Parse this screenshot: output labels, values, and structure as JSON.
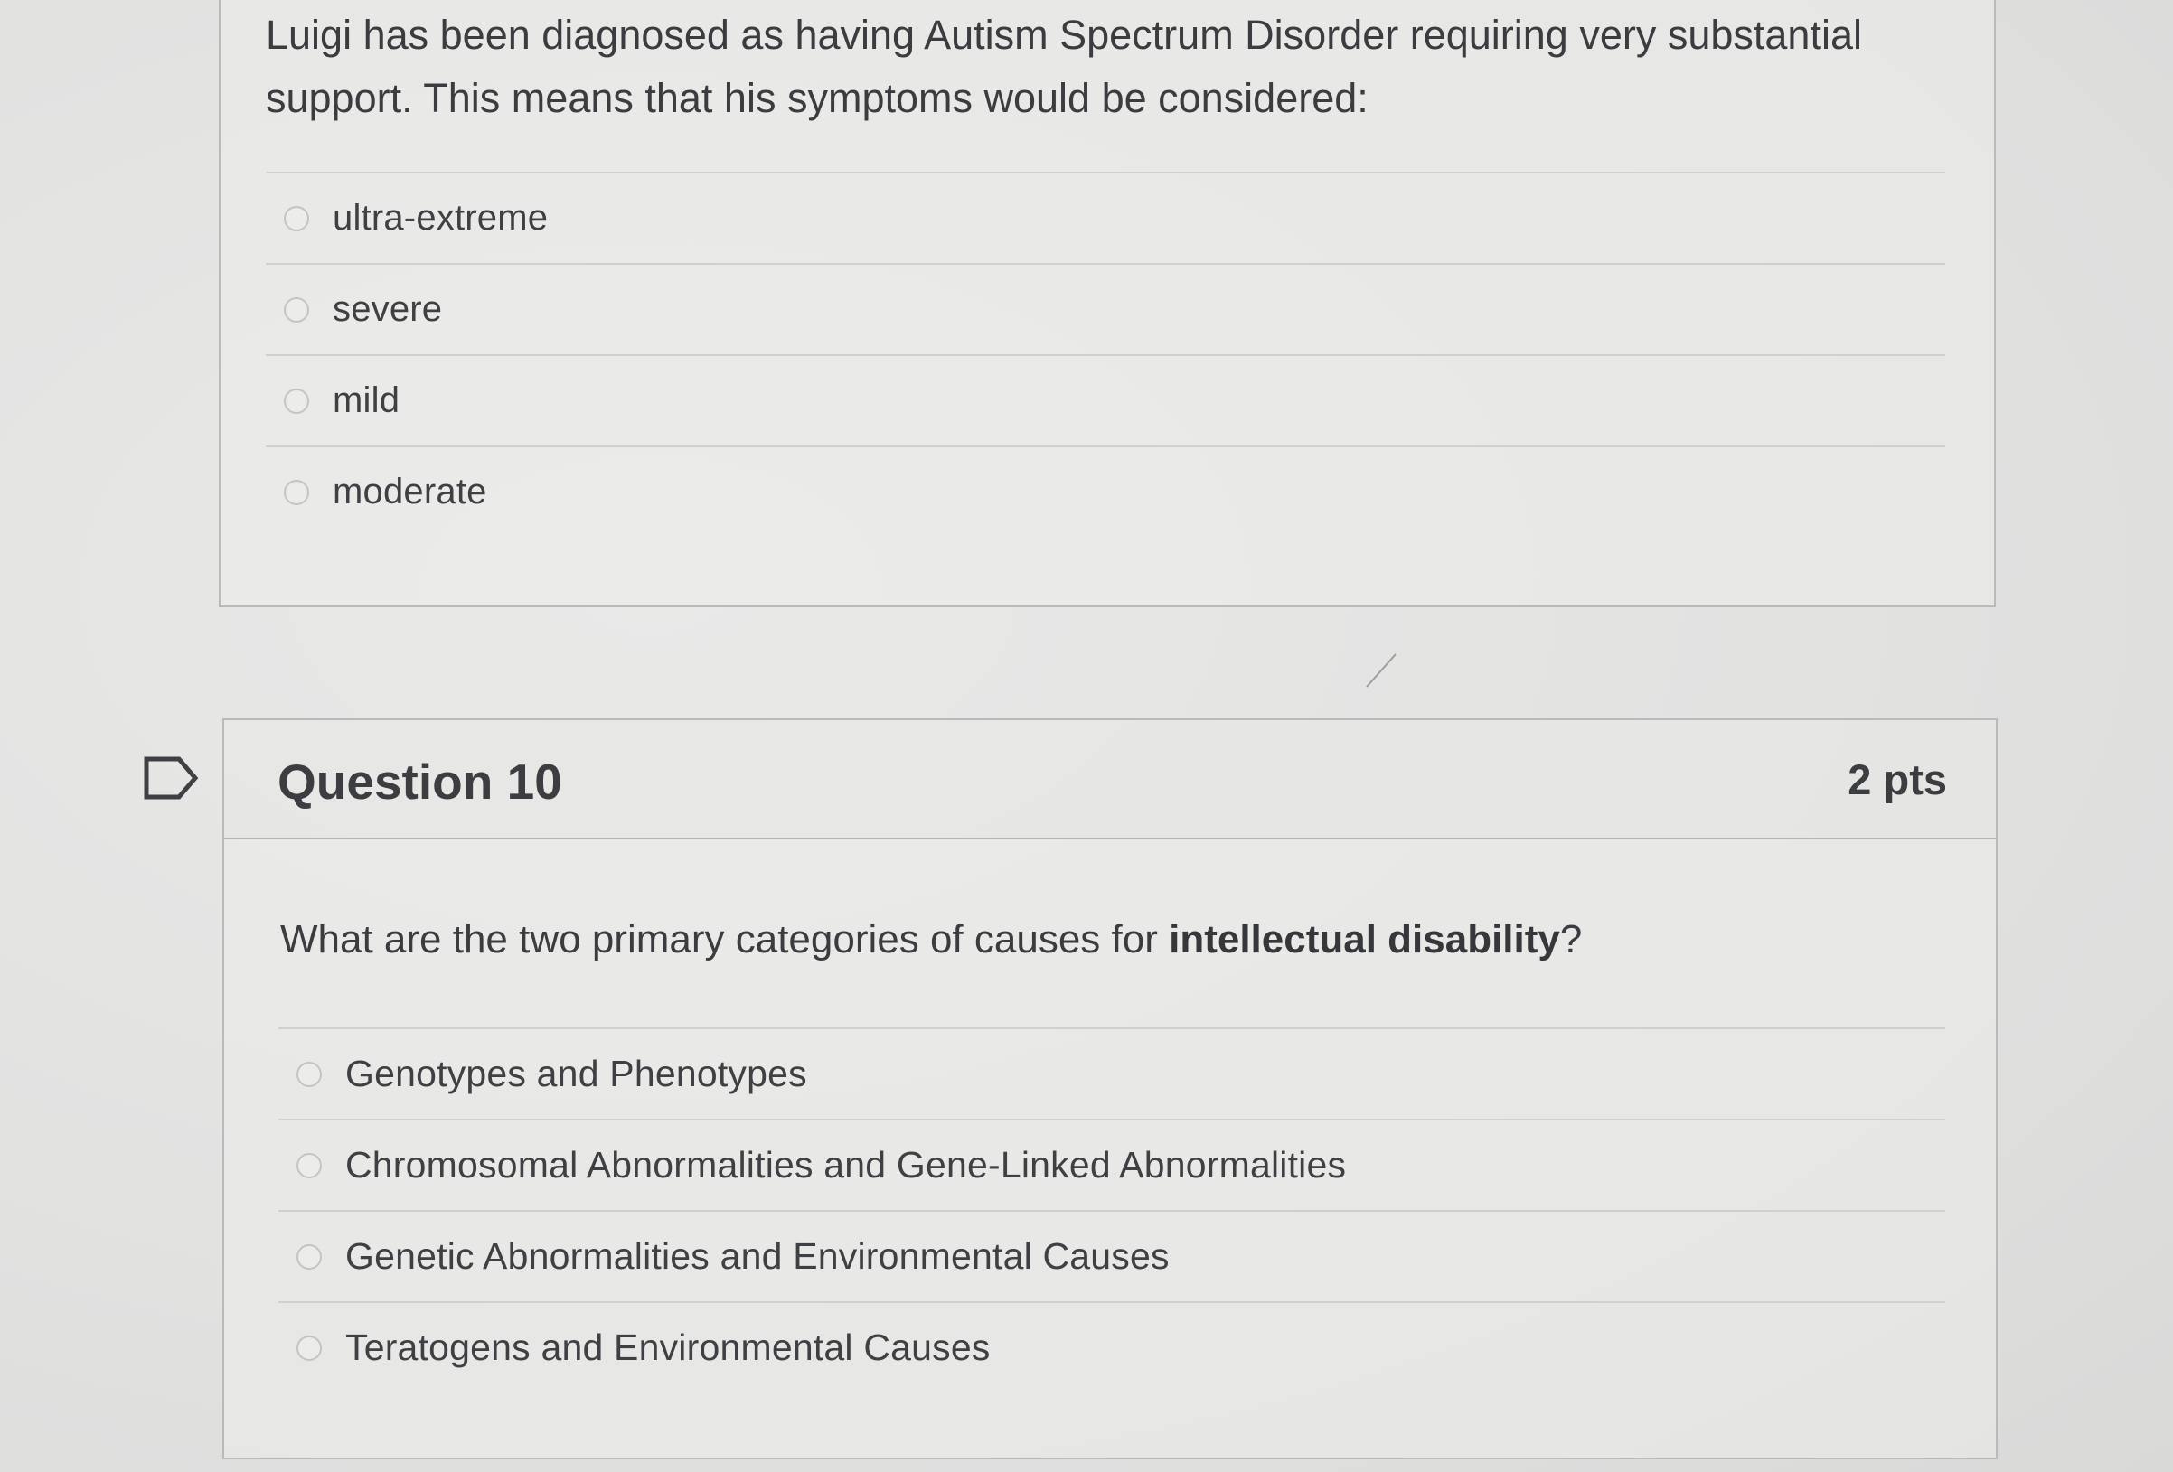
{
  "question_9": {
    "prompt": "Luigi has been diagnosed as having Autism Spectrum Disorder requiring very substantial support.  This means that his symptoms would be considered:",
    "answers": [
      {
        "label": "ultra-extreme"
      },
      {
        "label": "severe"
      },
      {
        "label": "mild"
      },
      {
        "label": "moderate"
      }
    ]
  },
  "question_10": {
    "title": "Question 10",
    "points": "2 pts",
    "prompt_start": "What are the two primary categories of causes for ",
    "prompt_bold": "intellectual disability",
    "prompt_end": "?",
    "answers": [
      {
        "label": "Genotypes and Phenotypes"
      },
      {
        "label": "Chromosomal Abnormalities and Gene-Linked Abnormalities"
      },
      {
        "label": "Genetic Abnormalities and Environmental Causes"
      },
      {
        "label": "Teratogens and Environmental Causes"
      }
    ]
  },
  "icons": {
    "flag": "flag-question-icon",
    "radio": "radio-unselected-icon"
  },
  "colors": {
    "background": "#e4e4e3",
    "border": "#b9bab9",
    "text": "#3b3c3f"
  }
}
